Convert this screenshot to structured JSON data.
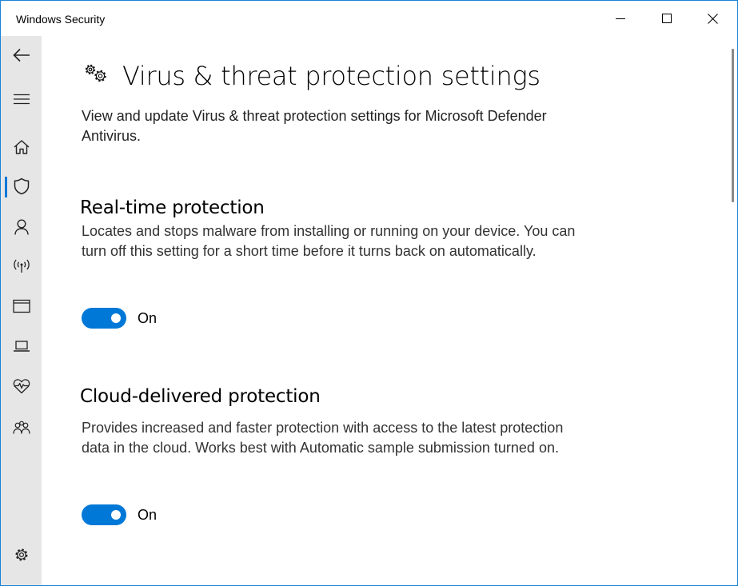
{
  "window": {
    "title": "Windows Security",
    "accent_color": "#0078d7",
    "border_color": "#1883d7"
  },
  "titlebar_buttons": [
    {
      "name": "minimize",
      "icon": "minimize-icon"
    },
    {
      "name": "maximize",
      "icon": "maximize-icon"
    },
    {
      "name": "close",
      "icon": "close-icon"
    }
  ],
  "sidebar": {
    "items": [
      {
        "name": "back",
        "icon": "back-arrow-icon"
      },
      {
        "name": "menu",
        "icon": "hamburger-menu-icon"
      },
      {
        "name": "home",
        "icon": "home-icon"
      },
      {
        "name": "virus-threat-protection",
        "icon": "shield-icon",
        "active": true
      },
      {
        "name": "account-protection",
        "icon": "person-icon"
      },
      {
        "name": "firewall-network",
        "icon": "wireless-signal-icon"
      },
      {
        "name": "app-browser-control",
        "icon": "browser-window-icon"
      },
      {
        "name": "device-security",
        "icon": "laptop-icon"
      },
      {
        "name": "device-performance-health",
        "icon": "heart-pulse-icon"
      },
      {
        "name": "family-options",
        "icon": "family-people-icon"
      },
      {
        "name": "settings",
        "icon": "gear-icon"
      }
    ]
  },
  "page": {
    "icon": "gears-icon",
    "title": "Virus & threat protection settings",
    "intro": "View and update Virus & threat protection settings for Microsoft Defender Antivirus."
  },
  "sections": [
    {
      "title": "Real-time protection",
      "description": "Locates and stops malware from installing or running on your device. You can turn off this setting for a short time before it turns back on automatically.",
      "toggle_state": "On",
      "enabled": true
    },
    {
      "title": "Cloud-delivered protection",
      "description": "Provides increased and faster protection with access to the latest protection data in the cloud. Works best with Automatic sample submission turned on.",
      "toggle_state": "On",
      "enabled": true
    }
  ]
}
